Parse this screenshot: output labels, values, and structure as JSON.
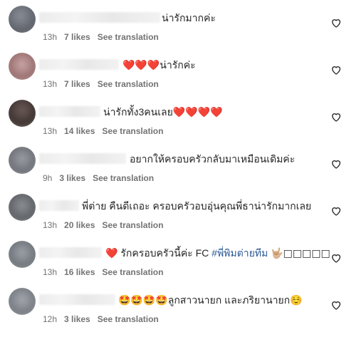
{
  "comments": [
    {
      "text": "น่ารักมากค่ะ",
      "time": "13h",
      "likes": "7 likes",
      "translate": "See translation"
    },
    {
      "hearts": "❤️❤️❤️",
      "text": "น่ารักค่ะ",
      "time": "13h",
      "likes": "7 likes",
      "translate": "See translation"
    },
    {
      "text": "น่ารักทั้ง3คนเลย",
      "hearts": "❤️❤️❤️❤️",
      "time": "13h",
      "likes": "14 likes",
      "translate": "See translation"
    },
    {
      "text": "อยากให้ครอบครัวกลับมาเหมือนเดิมค่ะ",
      "time": "9h",
      "likes": "3 likes",
      "translate": "See translation"
    },
    {
      "text": "พี่ต่าย คืนดีเถอะ ครอบครัวอบอุ่นคุณพี่ธาน่ารักมากเลย",
      "time": "13h",
      "likes": "20 likes",
      "translate": "See translation"
    },
    {
      "heart": "❤️",
      "text": "รักครอบครัวนี้ค่ะ FC",
      "hashtag": "#พี่พิมต่ายทีม",
      "tail": "🤟🏼□□□□□",
      "time": "13h",
      "likes": "16 likes",
      "translate": "See translation"
    },
    {
      "emojis": "🤩🤩🤩🤩",
      "text": "ลูกสาวนายก และภริยานายก☺️",
      "time": "12h",
      "likes": "3 likes",
      "translate": "See translation"
    }
  ],
  "icons": {
    "like": "heart-outline-icon"
  },
  "colors": {
    "text": "#262626",
    "meta": "#737373",
    "heart": "#e0112b",
    "hashtag": "#2c5a96"
  }
}
